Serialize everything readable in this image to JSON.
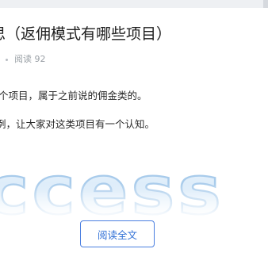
{
  "article": {
    "title": "思（返佣模式有哪些项目）",
    "meta": {
      "reads": "阅读 92"
    },
    "paragraphs": [
      "个项目，属于之前说的佣金类的。",
      "例，让大家对这类项目有一个认知。"
    ],
    "image": {
      "text": "ccess"
    }
  },
  "actions": {
    "read_more_label": "阅读全文"
  },
  "colors": {
    "accent": "#2f6fd6",
    "button_border": "#4a7fe0",
    "meta_text": "#9aa0a6",
    "image_text_fill": "#e6f1fb",
    "image_text_stroke": "#9cc3ea"
  }
}
